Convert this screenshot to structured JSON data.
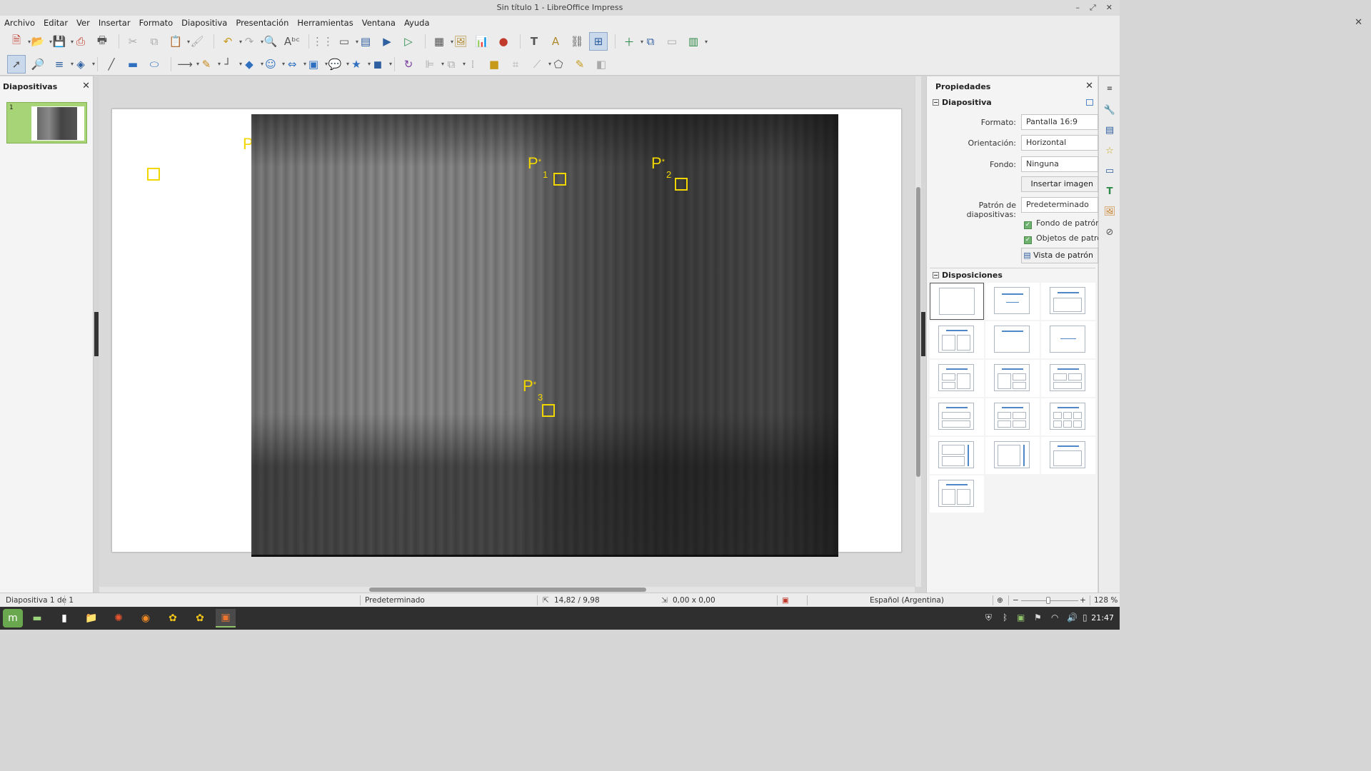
{
  "window": {
    "title": "Sin título 1 - LibreOffice Impress"
  },
  "menu": [
    "Archivo",
    "Editar",
    "Ver",
    "Insertar",
    "Formato",
    "Diapositiva",
    "Presentación",
    "Herramientas",
    "Ventana",
    "Ayuda"
  ],
  "slides_pane": {
    "title": "Diapositivas",
    "items": [
      {
        "number": "1"
      }
    ]
  },
  "slide": {
    "stray_letter": "P",
    "markers": [
      {
        "letter": "P",
        "sup": "*",
        "sub": "1"
      },
      {
        "letter": "P",
        "sup": "*",
        "sub": "2"
      },
      {
        "letter": "P",
        "sup": "*",
        "sub": "3"
      }
    ]
  },
  "properties": {
    "title": "Propiedades",
    "slide_section": {
      "heading": "Diapositiva",
      "format_label": "Formato:",
      "format_value": "Pantalla 16:9",
      "orientation_label": "Orientación:",
      "orientation_value": "Horizontal",
      "background_label": "Fondo:",
      "background_value": "Ninguna",
      "insert_image": "Insertar imagen",
      "master_label": "Patrón de diapositivas:",
      "master_value": "Predeterminado",
      "master_background": "Fondo de patrón",
      "master_objects": "Objetos de patrón",
      "master_view": "Vista de patrón"
    },
    "layouts_section": {
      "heading": "Disposiciones"
    }
  },
  "statusbar": {
    "slide_info": "Diapositiva 1 de 1",
    "master": "Predeterminado",
    "position": "14,82 / 9,98",
    "size": "0,00 x 0,00",
    "language": "Español (Argentina)",
    "zoom": "128 %"
  },
  "taskbar": {
    "clock": "21:47"
  },
  "colors": {
    "marker": "#f2d600",
    "thumb_selected": "#a6d476",
    "accent": "#4f87c7"
  }
}
